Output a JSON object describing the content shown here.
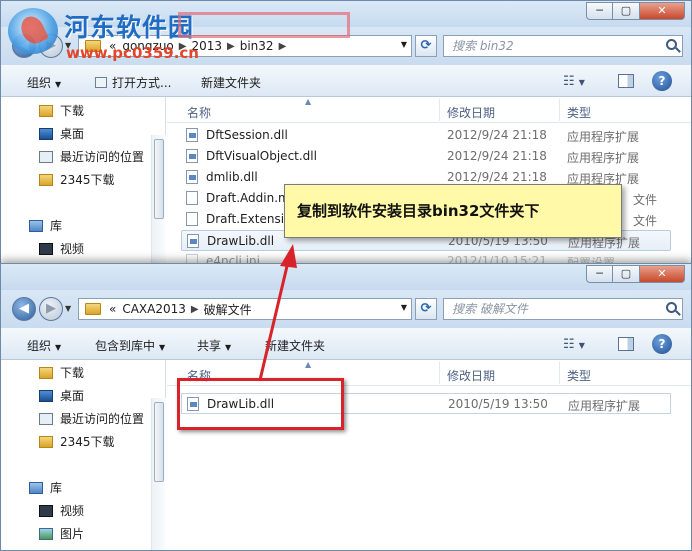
{
  "watermark": {
    "title": "河东软件园",
    "url": "www.pc0359.cn"
  },
  "window_back": {
    "breadcrumb": {
      "lead": "«",
      "parts": [
        "gongzuo",
        "2013",
        "bin32"
      ]
    },
    "search_placeholder": "搜索 bin32",
    "toolbar": {
      "organize": "组织",
      "open_with": "打开方式...",
      "new_folder": "新建文件夹"
    },
    "sidebar": [
      {
        "label": "下载",
        "icon": "folder-icon"
      },
      {
        "label": "桌面",
        "icon": "desktop-icon"
      },
      {
        "label": "最近访问的位置",
        "icon": "recent-places-icon"
      },
      {
        "label": "2345下载",
        "icon": "folder-icon"
      },
      {
        "label": "库",
        "icon": "library-icon"
      },
      {
        "label": "视频",
        "icon": "video-icon"
      }
    ],
    "columns": {
      "name": "名称",
      "date": "修改日期",
      "type": "类型"
    },
    "files": [
      {
        "name": "DftSession.dll",
        "date": "2012/9/24 21:18",
        "type": "应用程序扩展"
      },
      {
        "name": "DftVisualObject.dll",
        "date": "2012/9/24 21:18",
        "type": "应用程序扩展"
      },
      {
        "name": "dmlib.dll",
        "date": "2012/9/24 21:18",
        "type": "应用程序扩展"
      },
      {
        "name": "Draft.Addin.m",
        "date": "",
        "type": "文件"
      },
      {
        "name": "Draft.Extensic",
        "date": "",
        "type": "文件"
      },
      {
        "name": "DrawLib.dll",
        "date": "2010/5/19 13:50",
        "type": "应用程序扩展"
      },
      {
        "name": "e4ncli.ini",
        "date": "2012/1/10 15:21",
        "type": "配置设置"
      }
    ]
  },
  "window_front": {
    "breadcrumb": {
      "lead": "«",
      "parts": [
        "CAXA2013",
        "破解文件"
      ]
    },
    "search_placeholder": "搜索 破解文件",
    "toolbar": {
      "organize": "组织",
      "include_library": "包含到库中",
      "share": "共享",
      "new_folder": "新建文件夹"
    },
    "sidebar": [
      {
        "label": "下载",
        "icon": "folder-icon"
      },
      {
        "label": "桌面",
        "icon": "desktop-icon"
      },
      {
        "label": "最近访问的位置",
        "icon": "recent-places-icon"
      },
      {
        "label": "2345下载",
        "icon": "folder-icon"
      },
      {
        "label": "库",
        "icon": "library-icon"
      },
      {
        "label": "视频",
        "icon": "video-icon"
      },
      {
        "label": "图片",
        "icon": "picture-icon"
      }
    ],
    "columns": {
      "name": "名称",
      "date": "修改日期",
      "type": "类型"
    },
    "files": [
      {
        "name": "DrawLib.dll",
        "date": "2010/5/19 13:50",
        "type": "应用程序扩展"
      }
    ]
  },
  "annotation": {
    "callout_text": "复制到软件安装目录bin32文件夹下",
    "arrow_color": "#d8232a",
    "frame_color": "#d8232a",
    "callout_bg": "#fff9a8"
  }
}
